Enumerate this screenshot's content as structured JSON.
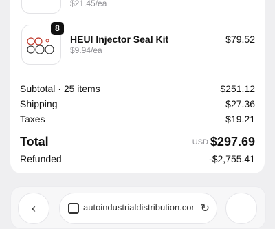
{
  "order": {
    "previous_item": {
      "unit_price": "$21.45/ea"
    },
    "item": {
      "name": "HEUI Injector Seal Kit",
      "unit_price": "$9.94/ea",
      "quantity": "8",
      "price": "$79.52"
    },
    "summary": {
      "subtotal_label": "Subtotal · 25 items",
      "subtotal_value": "$251.12",
      "shipping_label": "Shipping",
      "shipping_value": "$27.36",
      "taxes_label": "Taxes",
      "taxes_value": "$19.21",
      "total_label": "Total",
      "currency": "USD",
      "total_value": "$297.69",
      "refunded_label": "Refunded",
      "refunded_value": "-$2,755.41"
    }
  },
  "browser": {
    "back": "‹",
    "url": "autoindustrialdistribution.com",
    "reload": "↻"
  },
  "icons": [
    "product-thumbnail-icon",
    "seal-kit-icon",
    "back-icon",
    "tabs-icon",
    "reload-icon"
  ]
}
